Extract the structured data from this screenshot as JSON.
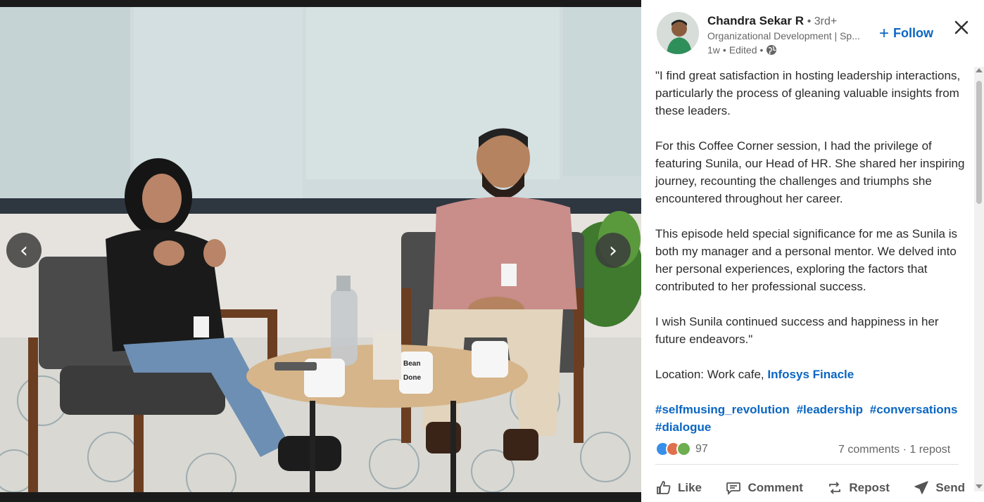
{
  "post": {
    "author": {
      "name": "Chandra Sekar R",
      "degree": "• 3rd+",
      "headline": "Organizational Development | Sp...",
      "time": "1w",
      "edited": "Edited",
      "separator": "•"
    },
    "follow_label": "Follow",
    "paragraphs": [
      "\"I find great satisfaction in hosting leadership interactions, particularly the process of gleaning valuable insights from these leaders.",
      "For this Coffee Corner session, I had the privilege of featuring Sunila, our Head of HR. She shared her inspiring journey, recounting the challenges and triumphs she encountered throughout her career.",
      "This episode held special significance for me as Sunila is both my manager and a personal mentor. We delved into her personal experiences, exploring the factors that contributed to her professional success.",
      "I wish Sunila continued success and happiness in her future endeavors.\""
    ],
    "location_prefix": "Location: Work cafe,",
    "location_link": "Infosys Finacle",
    "hashtags": [
      "#selfmusing_revolution",
      "#leadership",
      "#conversations",
      "#dialogue"
    ],
    "reaction_count": "97",
    "comments": "7 comments",
    "stats_separator": "·",
    "reposts": "1 repost",
    "actions": {
      "like": "Like",
      "comment": "Comment",
      "repost": "Repost",
      "send": "Send"
    }
  },
  "photo": {
    "mug_text": "Bean there Done that"
  },
  "icons": {
    "prev": "chevron-left-icon",
    "next": "chevron-right-icon",
    "close": "close-icon",
    "globe": "globe-icon"
  },
  "colors": {
    "brand": "#0a66c2",
    "muted": "#666666",
    "like_blue": "#378fe9",
    "love_red": "#df704d",
    "support_green": "#6dae4f"
  }
}
